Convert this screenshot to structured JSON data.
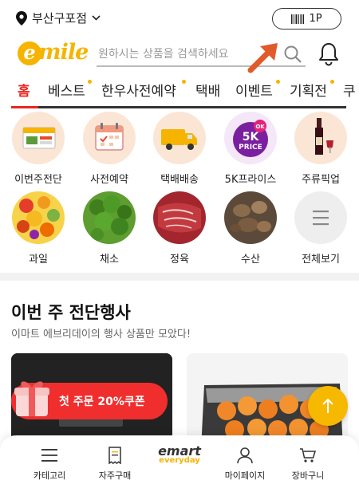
{
  "topbar": {
    "location": "부산구포점",
    "points": "1P"
  },
  "header": {
    "logo_text": "mile",
    "logo_e": "e",
    "search_placeholder": "원하시는 상품을 검색하세요"
  },
  "nav": {
    "items": [
      {
        "label": "홈",
        "active": true,
        "dot": false
      },
      {
        "label": "베스트",
        "active": false,
        "dot": true
      },
      {
        "label": "한우사전예약",
        "active": false,
        "dot": true
      },
      {
        "label": "택배",
        "active": false,
        "dot": false
      },
      {
        "label": "이벤트",
        "active": false,
        "dot": true
      },
      {
        "label": "기획전",
        "active": false,
        "dot": true
      },
      {
        "label": "쿠",
        "active": false,
        "dot": false
      }
    ]
  },
  "categories": [
    {
      "label": "이번주전단",
      "icon": "flyer-icon"
    },
    {
      "label": "사전예약",
      "icon": "calendar-icon"
    },
    {
      "label": "택배배송",
      "icon": "delivery-truck-icon"
    },
    {
      "label": "5K프라이스",
      "icon": "5k-price-badge-icon"
    },
    {
      "label": "주류픽업",
      "icon": "wine-bottle-icon"
    },
    {
      "label": "과일",
      "icon": "fruit-icon"
    },
    {
      "label": "채소",
      "icon": "vegetable-icon"
    },
    {
      "label": "정육",
      "icon": "meat-icon"
    },
    {
      "label": "수산",
      "icon": "seafood-icon"
    },
    {
      "label": "전체보기",
      "icon": "menu-lines-icon"
    }
  ],
  "badge_5k": {
    "line1": "5K",
    "line2": "PRICE",
    "ok": "OK"
  },
  "section": {
    "title": "이번 주 전단행사",
    "subtitle": "이마트 에브리데이의 행사 상품만 모았다!"
  },
  "coupon": {
    "label": "첫 주문 20%쿠폰"
  },
  "tabbar": {
    "items": [
      {
        "label": "카테고리",
        "icon": "hamburger-icon"
      },
      {
        "label": "자주구매",
        "icon": "receipt-icon"
      },
      {
        "label": "",
        "icon": "emart-everyday-logo"
      },
      {
        "label": "마이페이지",
        "icon": "person-icon"
      },
      {
        "label": "장바구니",
        "icon": "cart-icon"
      }
    ],
    "logo_top": "emart",
    "logo_bottom": "everyday"
  },
  "colors": {
    "accent_red": "#e8261f",
    "brand_yellow": "#f6b400",
    "coupon_red": "#f12e2e"
  }
}
